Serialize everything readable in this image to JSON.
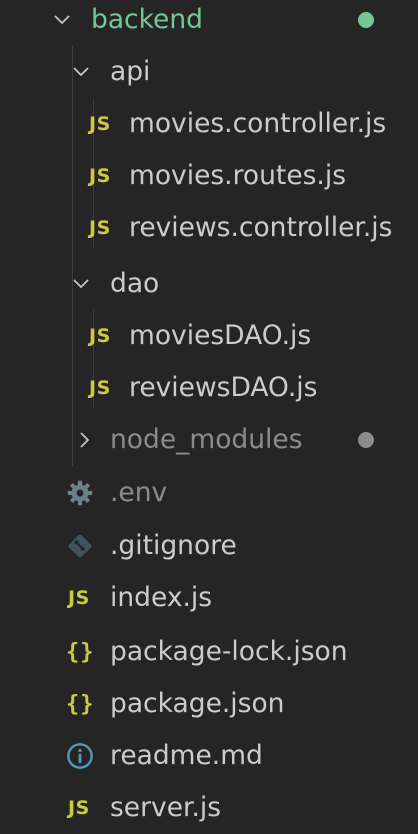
{
  "explorer": {
    "root": {
      "label": "backend",
      "icon": "chevron-down-icon",
      "status_color": "#73c991"
    },
    "api_folder": {
      "label": "api",
      "icon": "chevron-down-icon"
    },
    "api_files": [
      {
        "label": "movies.controller.js",
        "icon": "JS"
      },
      {
        "label": "movies.routes.js",
        "icon": "JS"
      },
      {
        "label": "reviews.controller.js",
        "icon": "JS"
      }
    ],
    "dao_folder": {
      "label": "dao",
      "icon": "chevron-down-icon"
    },
    "dao_files": [
      {
        "label": "moviesDAO.js",
        "icon": "JS"
      },
      {
        "label": "reviewsDAO.js",
        "icon": "JS"
      }
    ],
    "node_modules": {
      "label": "node_modules",
      "icon": "chevron-right-icon",
      "status_color": "#8c8c8c"
    },
    "root_files": [
      {
        "label": ".env",
        "icon": "gear-icon"
      },
      {
        "label": ".gitignore",
        "icon": "git-icon"
      },
      {
        "label": "index.js",
        "icon": "JS"
      },
      {
        "label": "package-lock.json",
        "icon": "{ }"
      },
      {
        "label": "package.json",
        "icon": "{ }"
      },
      {
        "label": "readme.md",
        "icon": "info-icon"
      },
      {
        "label": "server.js",
        "icon": "JS"
      }
    ]
  },
  "colors": {
    "background": "#252526",
    "text": "#cccccc",
    "modified_folder": "#73c991",
    "ignored": "#8c8c8c",
    "js_icon": "#cbcb41",
    "json_icon": "#cbcb41",
    "gear_icon": "#6d8086",
    "git_icon": "#41535b",
    "info_icon": "#519aba"
  }
}
